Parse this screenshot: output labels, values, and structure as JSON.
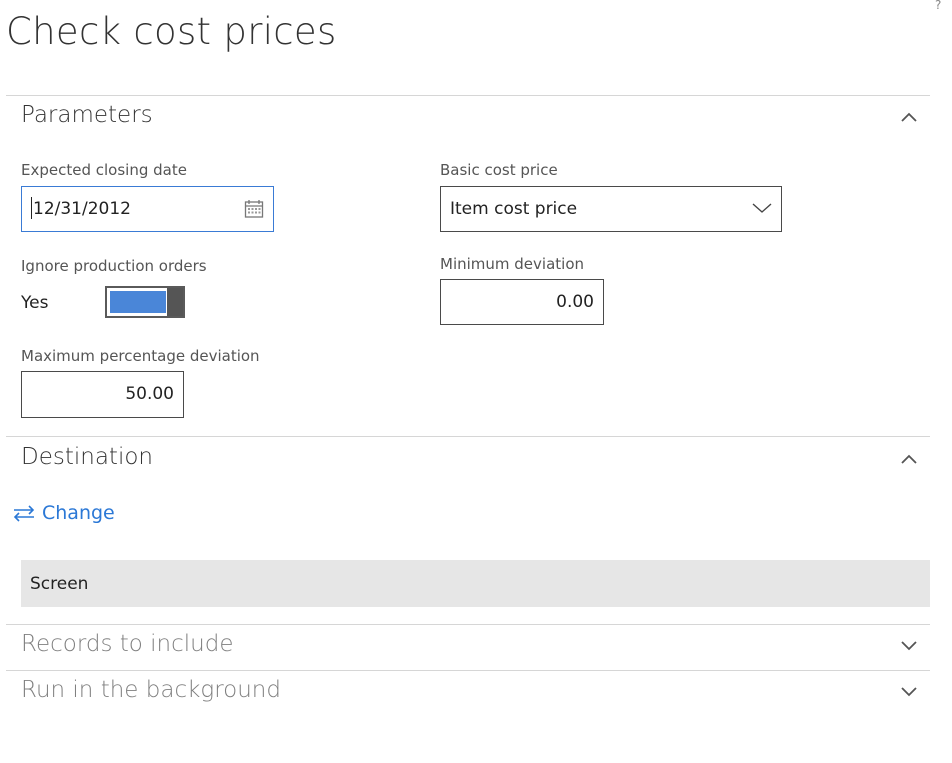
{
  "page": {
    "title": "Check cost prices",
    "help_glyph": "?"
  },
  "parameters": {
    "header": "Parameters",
    "expected_closing_date": {
      "label": "Expected closing date",
      "value": "12/31/2012",
      "icon": "calendar-icon"
    },
    "basic_cost_price": {
      "label": "Basic cost price",
      "value": "Item cost price",
      "icon": "chevron-down-icon"
    },
    "ignore_production_orders": {
      "label": "Ignore production orders",
      "value": "Yes",
      "on": true
    },
    "minimum_deviation": {
      "label": "Minimum deviation",
      "value": "0.00"
    },
    "maximum_percentage_deviation": {
      "label": "Maximum percentage deviation",
      "value": "50.00"
    }
  },
  "destination": {
    "header": "Destination",
    "change_label": "Change",
    "change_icon": "swap-arrows-icon",
    "target": "Screen"
  },
  "records_to_include": {
    "header": "Records to include"
  },
  "run_in_background": {
    "header": "Run in the background"
  },
  "colors": {
    "accent": "#2b78d6",
    "toggle_fill": "#4a86d8",
    "focus_border": "#3a7bd5",
    "row_background": "#e6e6e6"
  }
}
